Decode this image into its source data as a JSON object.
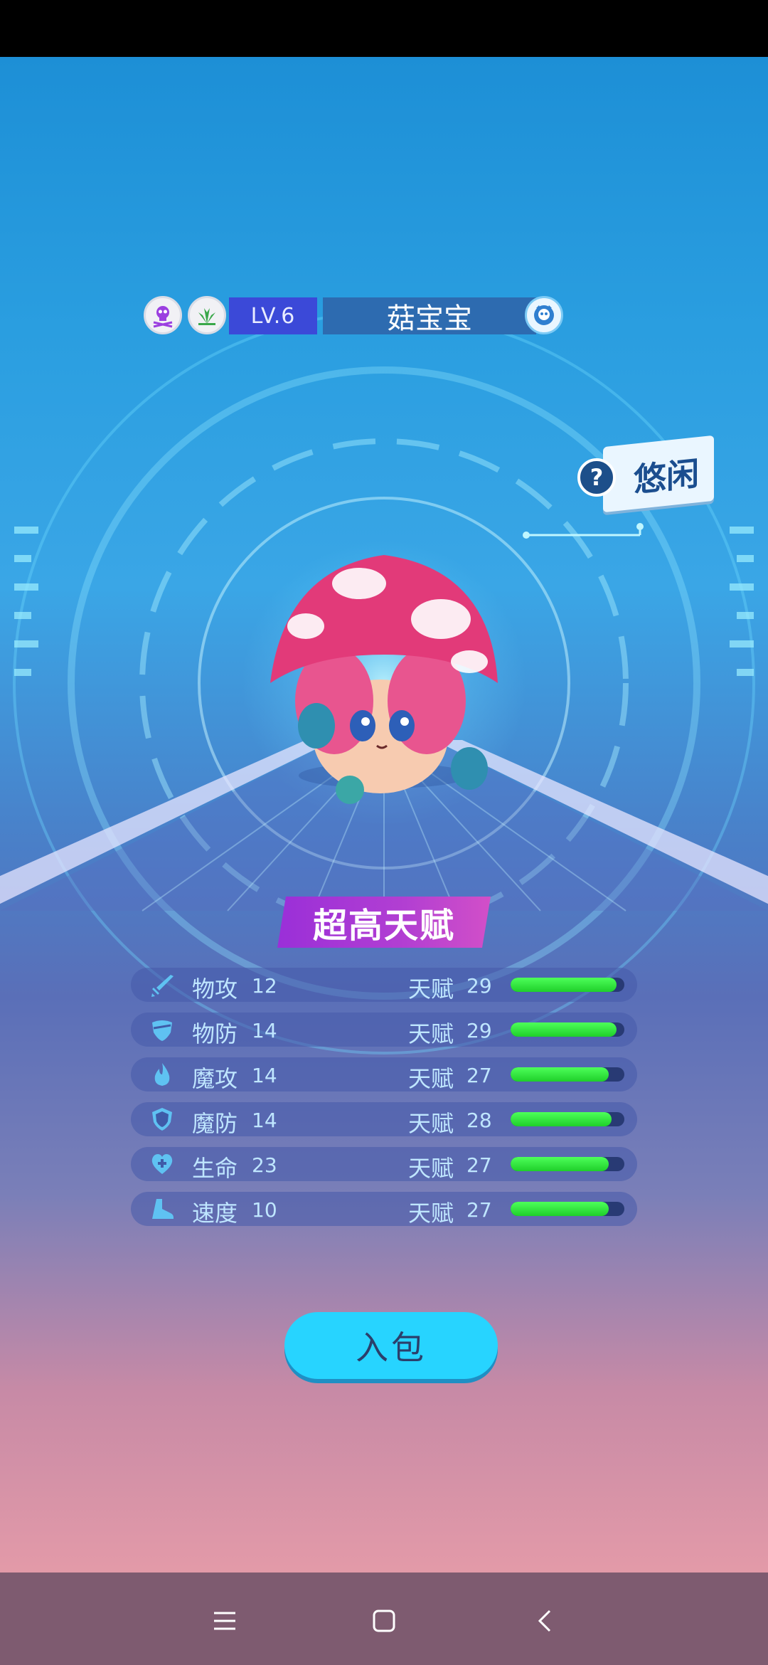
{
  "pet": {
    "level": "LV.6",
    "name": "菇宝宝",
    "mood": "悠闲",
    "mood_help": "?",
    "type_icons": [
      "poison-icon",
      "grass-icon"
    ]
  },
  "talent_banner": "超高天赋",
  "stats": [
    {
      "name": "物攻",
      "value": "12",
      "talent_label": "天赋",
      "talent": "29",
      "fill": 0.93,
      "icon": "sword-icon"
    },
    {
      "name": "物防",
      "value": "14",
      "talent_label": "天赋",
      "talent": "29",
      "fill": 0.93,
      "icon": "armor-icon"
    },
    {
      "name": "魔攻",
      "value": "14",
      "talent_label": "天赋",
      "talent": "27",
      "fill": 0.86,
      "icon": "fire-icon"
    },
    {
      "name": "魔防",
      "value": "14",
      "talent_label": "天赋",
      "talent": "28",
      "fill": 0.89,
      "icon": "shield-icon"
    },
    {
      "name": "生命",
      "value": "23",
      "talent_label": "天赋",
      "talent": "27",
      "fill": 0.86,
      "icon": "heart-plus-icon"
    },
    {
      "name": "速度",
      "value": "10",
      "talent_label": "天赋",
      "talent": "27",
      "fill": 0.86,
      "icon": "boot-icon"
    }
  ],
  "pack_button": "入包",
  "colors": {
    "bar_fill": "#2fe23c",
    "button": "#27d4ff",
    "banner": "#b23fd2"
  }
}
